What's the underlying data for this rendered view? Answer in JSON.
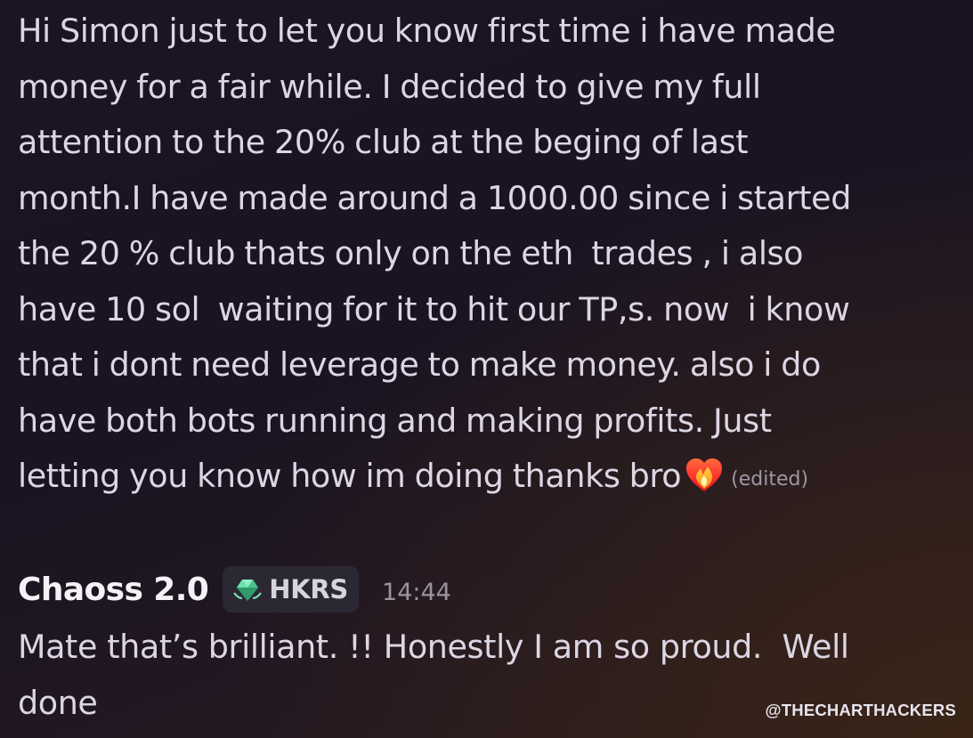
{
  "message": {
    "lines": [
      "Hi Simon just to let you know first time i have made",
      "money for a fair while. I decided to give my full",
      "attention to the 20% club at the beging of last",
      "month.I have made around a 1000.00 since i started",
      "the 20 % club thats only on the eth  trades , i also",
      "have 10 sol  waiting for it to hit our TP,s. now  i know",
      "that i dont need leverage to make money. also i do",
      "have both bots running and making profits. Just",
      "letting you know how im doing thanks bro"
    ],
    "emoji": "heart-on-fire-icon",
    "edited_label": "(edited)"
  },
  "reply": {
    "username": "Chaoss 2.0",
    "role_icon": "green-gem-icon",
    "role_label": "HKRS",
    "timestamp": "14:44",
    "lines": [
      "Mate that’s brilliant. !! Honestly I am so proud.  Well",
      "done"
    ]
  },
  "watermark": "@THECHARTHACKERS",
  "colors": {
    "background": "#1b1523",
    "text": "#dcd6e4",
    "username": "#f4f2f7",
    "muted": "#9c97a6",
    "role_tag_bg": "#2b2834",
    "gem": "#5fd6a0",
    "heart": "#ff3b3b"
  }
}
